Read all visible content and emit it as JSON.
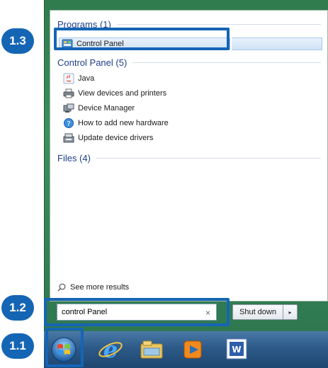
{
  "start_menu": {
    "programs_header": "Programs (1)",
    "programs_items": [
      {
        "label": "Control Panel",
        "icon": "control-panel-icon"
      }
    ],
    "control_panel_header": "Control Panel (5)",
    "control_panel_items": [
      {
        "label": "Java",
        "icon": "java-icon"
      },
      {
        "label": "View devices and printers",
        "icon": "printer-icon"
      },
      {
        "label": "Device Manager",
        "icon": "device-manager-icon"
      },
      {
        "label": "How to add new hardware",
        "icon": "help-icon"
      },
      {
        "label": "Update device drivers",
        "icon": "driver-icon"
      }
    ],
    "files_header": "Files (4)",
    "see_more": "See more results"
  },
  "search": {
    "value": "control Panel",
    "clear_glyph": "×"
  },
  "shutdown": {
    "label": "Shut down",
    "arrow_glyph": "▸"
  },
  "taskbar": {
    "items": [
      {
        "icon": "start-orb-icon"
      },
      {
        "icon": "internet-explorer-icon"
      },
      {
        "icon": "file-explorer-icon"
      },
      {
        "icon": "media-player-icon"
      },
      {
        "icon": "word-icon"
      }
    ]
  },
  "callouts": [
    {
      "label": "1.1"
    },
    {
      "label": "1.2"
    },
    {
      "label": "1.3"
    }
  ],
  "colors": {
    "callout_blue": "#1565b5",
    "header_blue": "#1e3f8a",
    "menu_frame_green": "#3c8f5f"
  }
}
